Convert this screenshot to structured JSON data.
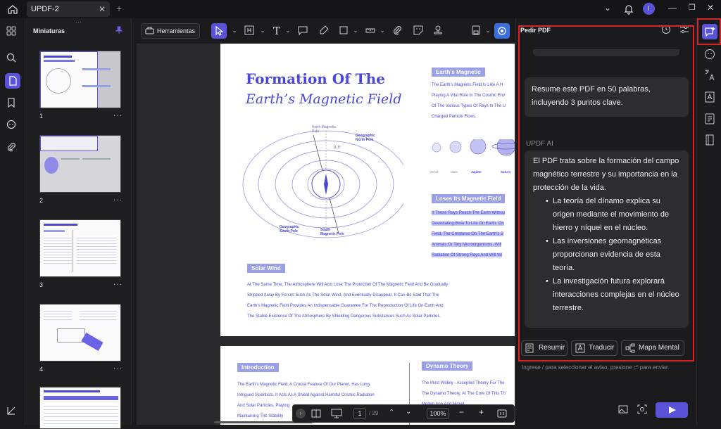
{
  "window": {
    "tab_title": "UPDF-2",
    "avatar_letter": "I"
  },
  "thumbnails": {
    "title": "Miniaturas",
    "pages": [
      "1",
      "2",
      "3",
      "4"
    ]
  },
  "toolbar": {
    "tools_label": "Herramientas"
  },
  "document": {
    "title_line1": "Formation Of The",
    "title_line2": "Earth’s Magnetic Field",
    "heading_magnetic": "Earth’s Magnetic",
    "magnetic_lines": [
      "The Earth’s Magnetic Field Is Like A H",
      "Playing A Vital Role In The Cosmic Env",
      "Of The Various Types Of Rays In The U",
      "Charged Particle Flows."
    ],
    "diagram_labels": {
      "north_magnetic": "North Magnetic Pole",
      "geo_north": "Geographic North Pole",
      "geo_south": "Geographic South Pole",
      "south_magnetic": "South Magnetic Pole",
      "angle": "11.5°"
    },
    "planets": [
      "Venus",
      "Mars",
      "Jupiter",
      "Saturn"
    ],
    "heading_loses": "Loses Its Magnetic Field",
    "loses_lines": [
      "If These Rays Reach The Earth Withou",
      "Devastating Blow To Life On Earth. On",
      "Field, The Creatures On The Earth's S",
      "Animals Or Tiny Microorganisms, Will ",
      "Radiation Of Strong Rays And Will Wi"
    ],
    "heading_solar": "Solar Wind",
    "solar_lines": [
      "At The Same Time, The Atmosphere Will Also Lose The Protection Of The Magnetic Field And Be Gradually",
      "Stripped Away By Forces Such As The Solar Wind, And Eventually Disappear. It Can Be Said That The",
      "Earth's Magnetic Field Provides An Indispensable Guarantee For The Reproduction Of Life On Earth And",
      "The Stable Existence Of The Atmosphere By Shielding Dangerous Substances Such As Solar Particles."
    ],
    "heading_intro": "Introduction",
    "intro_lines": [
      "The Earth's Magnetic Field, A Crucial Feature Of Our Planet, Has Long",
      "Intrigued Scientists. It Acts As A Shield Against Harmful Cosmic Radiation",
      "And Solar Particles, Playing",
      "Maintaining The Stability"
    ],
    "heading_dynamo": "Dynamo Theory",
    "dynamo_lines": [
      "The Most Widely - Accepted Theory For The",
      "The Dynamo Theory. At The Core Of This Th",
      "Molten Iron And Nickel"
    ]
  },
  "bottom_nav": {
    "current_page": "1",
    "total_pages": "/ 29",
    "zoom": "100%"
  },
  "ai_panel": {
    "title": "Pedir PDF",
    "user_message": "Resume este PDF en 50 palabras, incluyendo 3 puntos clave.",
    "ai_label": "UPDF AI",
    "ai_intro": "El PDF trata sobre la formación del campo magnético terrestre y su importancia en la protección de la vida.",
    "ai_points": [
      "La teoría del dínamo explica su origen mediante el movimiento de hierro y níquel en el núcleo.",
      "Las inversiones geomagnéticas proporcionan evidencia de esta teoría.",
      "La investigación futura explorará interacciones complejas en el núcleo terrestre."
    ],
    "actions": {
      "summarize": "Resumir",
      "translate": "Traducir",
      "mindmap": "Mapa Mental"
    },
    "prompt_placeholder": "Ingrese / para seleccionar el aviso, presione ⏎ para enviar."
  },
  "colors": {
    "accent": "#5a52d8",
    "highlight_frame": "#d7262b",
    "doc_text": "#4b47d6"
  }
}
